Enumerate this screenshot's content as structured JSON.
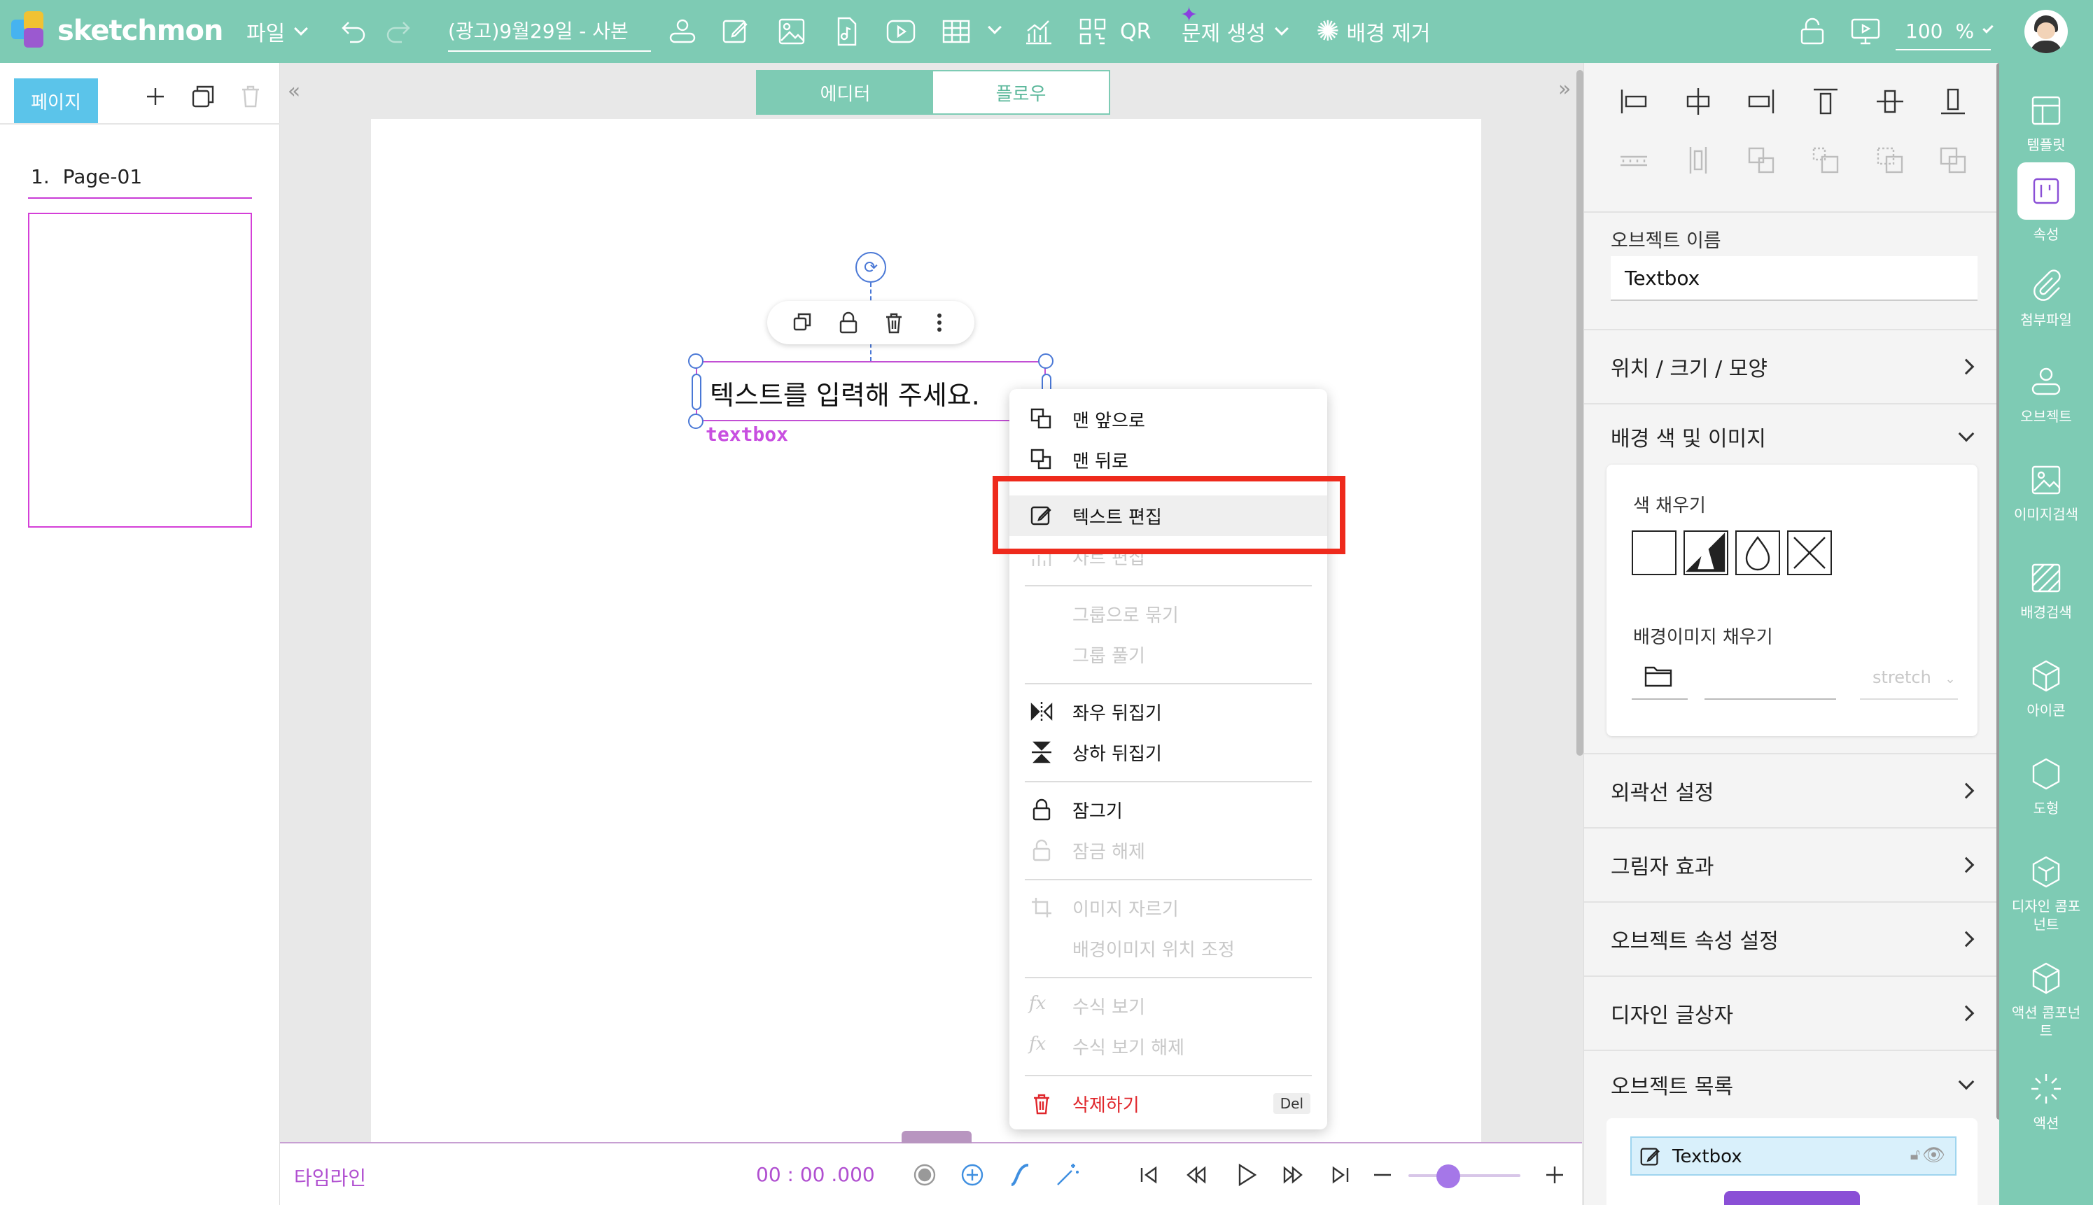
{
  "topbar": {
    "brand": "sketchmon",
    "file_menu": "파일",
    "doc_title": "(광고)9월29일 - 사본",
    "qr_label": "QR",
    "quiz_gen": "문제 생성",
    "bg_remove": "배경 제거",
    "zoom_value": "100",
    "zoom_unit": "%"
  },
  "pages_panel": {
    "tab_label": "페이지",
    "page_number": "1.",
    "page_name": "Page-01"
  },
  "mode_toggle": {
    "editor": "에디터",
    "flow": "플로우"
  },
  "canvas": {
    "textbox_text": "텍스트를 입력해 주세요.",
    "textbox_tag": "textbox"
  },
  "context_menu": {
    "bring_front": "맨 앞으로",
    "send_back": "맨 뒤로",
    "edit_text": "텍스트 편집",
    "edit_chart": "차트 편집",
    "group": "그룹으로 묶기",
    "ungroup": "그룹 풀기",
    "flip_h": "좌우 뒤집기",
    "flip_v": "상하 뒤집기",
    "lock": "잠그기",
    "unlock": "잠금 해제",
    "crop_image": "이미지 자르기",
    "bg_image_pos": "배경이미지 위치 조정",
    "show_formula": "수식 보기",
    "hide_formula": "수식 보기 해제",
    "delete": "삭제하기",
    "delete_shortcut": "Del"
  },
  "timeline": {
    "label": "타임라인",
    "time": "00 : 00 .000"
  },
  "properties": {
    "object_name_label": "오브젝트 이름",
    "object_name_value": "Textbox",
    "pos_size_shape": "위치 / 크기 / 모양",
    "bg_color_image": "배경 색 및 이미지",
    "fill_color": "색 채우기",
    "bg_image_fill": "배경이미지 채우기",
    "stretch_option": "stretch",
    "outline": "외곽선 설정",
    "shadow": "그림자 효과",
    "object_props": "오브젝트 속성 설정",
    "design_textbox": "디자인 글상자",
    "object_list": "오브젝트 목록",
    "object_list_item": "Textbox"
  },
  "iconbar": {
    "template": "템플릿",
    "properties": "속성",
    "attachment": "첨부파일",
    "objects": "오브젝트",
    "image_search": "이미지검색",
    "bg_search": "배경검색",
    "icons": "아이콘",
    "shapes": "도형",
    "design_components": "디자인 콤포넌트",
    "action_components": "액션 콤포넌트",
    "actions": "액션"
  },
  "colors": {
    "brand": "#7ecbb4",
    "accent_purple": "#a577e8",
    "highlight_red": "#ee2a1c",
    "danger": "#e0262b"
  }
}
